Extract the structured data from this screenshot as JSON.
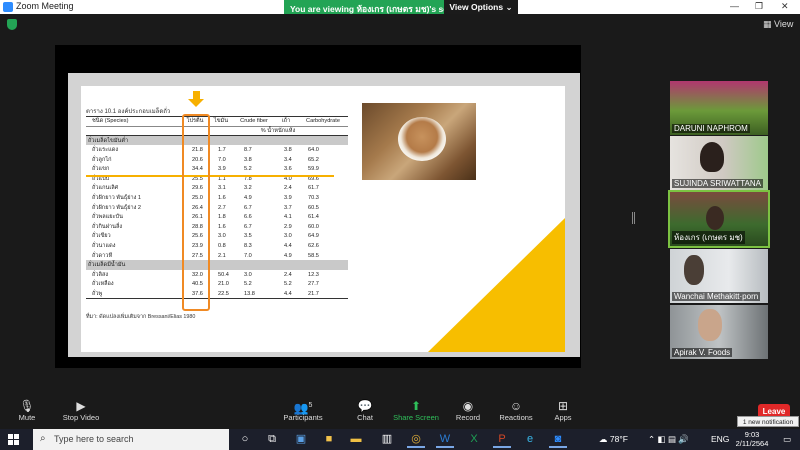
{
  "window": {
    "title": "Zoom Meeting",
    "minimize": "—",
    "maximize": "❐",
    "close": "✕"
  },
  "banner": {
    "viewing_text": "You are viewing ห้องเกร (เกษตร มช)'s screen",
    "view_options": "View Options ⌄"
  },
  "top_right": {
    "view_label": "View"
  },
  "slide": {
    "caption": "ตาราง 10.1  องค์ประกอบเมล็ดถั่ว",
    "headers": [
      "ชนิด (Species)",
      "โปรตีน",
      "ไขมัน",
      "Crude fiber",
      "เถ้า",
      "Carbohydrate"
    ],
    "subheader": "% น้ำหนักแห้ง",
    "group1": "ถั่วเมล็ดไขมันต่ำ",
    "rows1": [
      [
        "ถั่วแระแดง",
        "21.8",
        "1.7",
        "8.7",
        "3.8",
        "64.0"
      ],
      [
        "ถั่วลูกไก่",
        "20.6",
        "7.0",
        "3.8",
        "3.4",
        "65.2"
      ],
      [
        "ถั่วแขก",
        "34.4",
        "3.9",
        "5.2",
        "3.6",
        "59.9"
      ],
      [
        "ถั่วแปบี",
        "25.5",
        "1.1",
        "7.8",
        "4.0",
        "69.6"
      ],
      [
        "ถั่วแกนเลิศ",
        "29.6",
        "3.1",
        "3.2",
        "2.4",
        "61.7"
      ],
      [
        "ถั่วฝักยาว พันธุ์ย่าง 1",
        "25.0",
        "1.6",
        "4.9",
        "3.9",
        "70.3"
      ],
      [
        "ถั่วฝักยาว พันธุ์ย่าง 2",
        "26.4",
        "2.7",
        "6.7",
        "3.7",
        "60.5"
      ],
      [
        "ถั่วพลแยะบัน",
        "26.1",
        "1.8",
        "6.6",
        "4.1",
        "61.4"
      ],
      [
        "ถั่วกินฝานลี่ง",
        "28.8",
        "1.6",
        "6.7",
        "2.9",
        "60.0"
      ],
      [
        "ถั่วเขียว",
        "25.6",
        "3.0",
        "3.5",
        "3.0",
        "64.9"
      ],
      [
        "ถั่วนาแดง",
        "23.9",
        "0.8",
        "8.3",
        "4.4",
        "62.6"
      ],
      [
        "ถั่วดาวหี",
        "27.5",
        "2.1",
        "7.0",
        "4.9",
        "58.5"
      ]
    ],
    "group2": "ถั่วเมล็ดมีน้ำมัน",
    "rows2": [
      [
        "ถั่วลิสง",
        "32.0",
        "50.4",
        "3.0",
        "2.4",
        "12.3"
      ],
      [
        "ถั่วเหลือง",
        "40.5",
        "21.0",
        "5.2",
        "5.2",
        "27.7"
      ],
      [
        "ถั่วพู",
        "37.6",
        "22.5",
        "13.8",
        "4.4",
        "21.7"
      ]
    ],
    "source": "ที่มา: ดัดแปลงเพิ่มเติมจาก Bressani/Elias 1980"
  },
  "participants": [
    {
      "name": "DARUNI NAPHROM"
    },
    {
      "name": "SUJINDA SRIWATTANA"
    },
    {
      "name": "ห้องเกร (เกษตร มช)"
    },
    {
      "name": "Wanchai Methakitt·porn"
    },
    {
      "name": "Apirak V. Foods"
    }
  ],
  "controls": {
    "mute": "Mute",
    "stop_video": "Stop Video",
    "participants": "Participants",
    "participants_count": "5",
    "chat": "Chat",
    "share_screen": "Share Screen",
    "record": "Record",
    "reactions": "Reactions",
    "apps": "Apps",
    "leave": "Leave",
    "notification": "1 new notification"
  },
  "taskbar": {
    "search_placeholder": "Type here to search",
    "weather": "78°F",
    "language": "ENG",
    "time": "9:03",
    "date": "2/11/2564"
  },
  "colors": {
    "accent_green": "#23a455",
    "highlight_orange": "#f08a24",
    "slide_yellow": "#f7be00",
    "leave_red": "#e02828"
  }
}
